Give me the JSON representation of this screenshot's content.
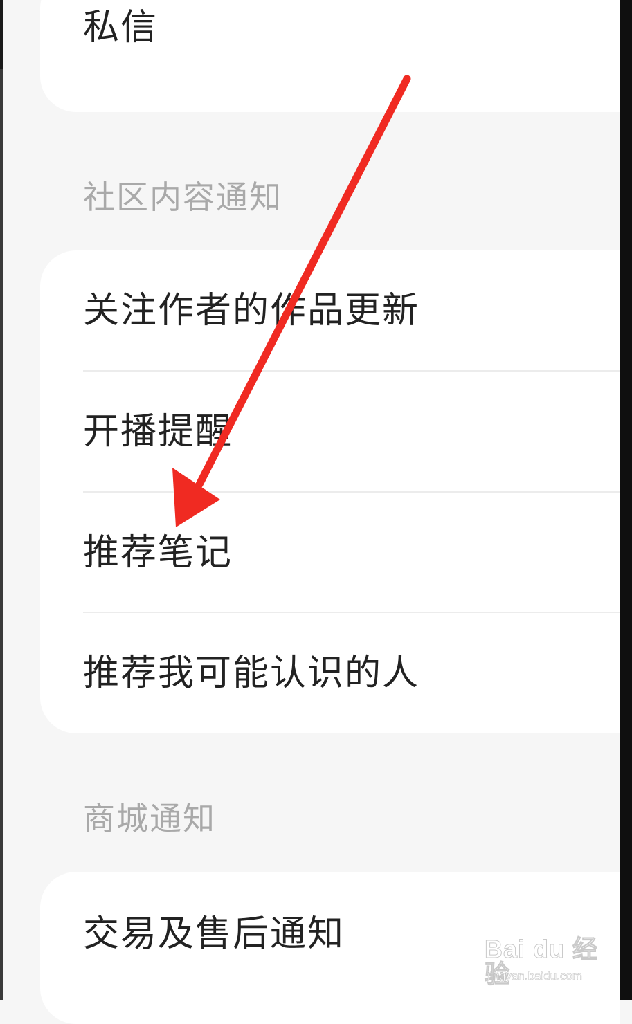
{
  "cards": {
    "direct_messages": {
      "items": [
        {
          "label": "私信"
        }
      ]
    },
    "community": {
      "header": "社区内容通知",
      "items": [
        {
          "label": "关注作者的作品更新"
        },
        {
          "label": "开播提醒"
        },
        {
          "label": "推荐笔记"
        },
        {
          "label": "推荐我可能认识的人"
        }
      ]
    },
    "mall": {
      "header": "商城通知",
      "items": [
        {
          "label": "交易及售后通知"
        }
      ]
    }
  },
  "annotation": {
    "arrow_color": "#f02a22",
    "points_to": "推荐笔记"
  },
  "watermark": {
    "brand": "Bai du 经验",
    "url": "jingyan.baidu.com"
  },
  "colors": {
    "background": "#f6f6f6",
    "card": "#ffffff",
    "item_text": "#222222",
    "section_header_text": "#a9a9a9",
    "divider": "#ececec"
  }
}
